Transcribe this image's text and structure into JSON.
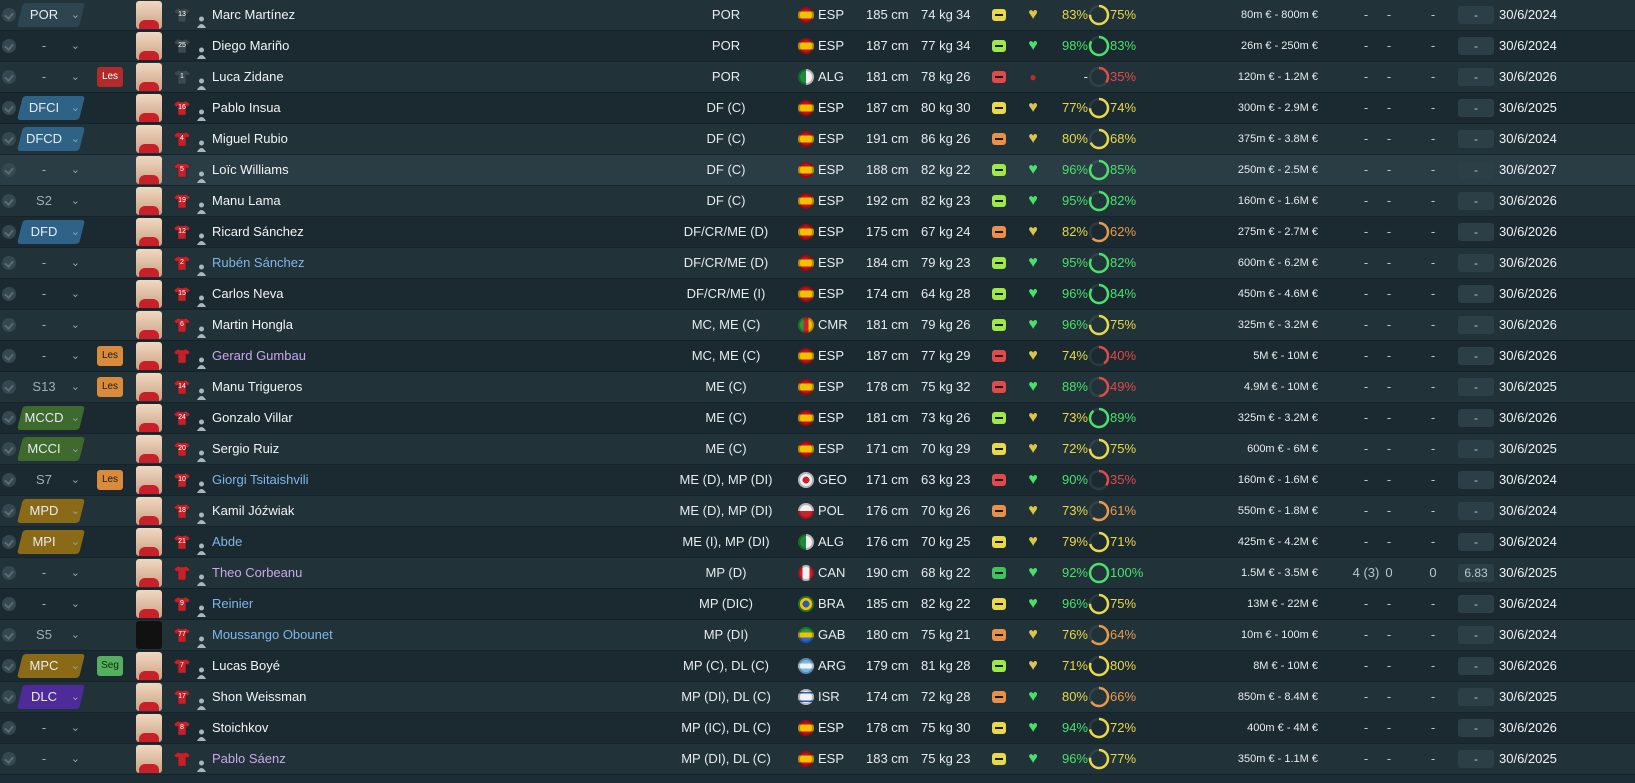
{
  "players": [
    {
      "pos_sel": "POR",
      "pos_style": "grey",
      "tag": "",
      "shirt_num": "13",
      "name": "Marc Martínez",
      "name_color": "white",
      "positions": "POR",
      "nationality": "ESP",
      "flag": "esp",
      "height": "185 cm",
      "weight": "74 kg",
      "age": "34",
      "status": "yellow",
      "morale": "yellow",
      "condition": "83%",
      "cond_color": "#e8d84a",
      "sharpness": "75%",
      "sharp_color": "#e8d84a",
      "sharp_frac": 0.75,
      "value": "80m € - 800m €",
      "apps": "-",
      "goals": "-",
      "assists": "-",
      "rating": "-",
      "contract": "30/6/2024"
    },
    {
      "pos_sel": "-",
      "pos_style": "none",
      "tag": "",
      "shirt_num": "25",
      "name": "Diego Mariño",
      "name_color": "white",
      "positions": "POR",
      "nationality": "ESP",
      "flag": "esp",
      "height": "187 cm",
      "weight": "77 kg",
      "age": "34",
      "status": "lime",
      "morale": "green",
      "condition": "98%",
      "cond_color": "#4ae06a",
      "sharpness": "83%",
      "sharp_color": "#4ae06a",
      "sharp_frac": 0.83,
      "value": "26m € - 250m €",
      "apps": "-",
      "goals": "-",
      "assists": "-",
      "rating": "-",
      "contract": "30/6/2024"
    },
    {
      "pos_sel": "-",
      "pos_style": "none",
      "tag": "Les",
      "tag_style": "les-red",
      "shirt_num": "1",
      "name": "Luca Zidane",
      "name_color": "white",
      "positions": "POR",
      "nationality": "ALG",
      "flag": "alg",
      "height": "181 cm",
      "weight": "78 kg",
      "age": "26",
      "status": "red",
      "morale": "red",
      "condition": "-",
      "cond_color": "#e6ecef",
      "sharpness": "35%",
      "sharp_color": "#e04a4a",
      "sharp_frac": 0.35,
      "value": "120m € - 1.2M €",
      "apps": "-",
      "goals": "-",
      "assists": "-",
      "rating": "-",
      "contract": "30/6/2026"
    },
    {
      "pos_sel": "DFCI",
      "pos_style": "blue",
      "tag": "",
      "shirt_num": "16",
      "name": "Pablo Insua",
      "name_color": "white",
      "positions": "DF (C)",
      "nationality": "ESP",
      "flag": "esp",
      "height": "187 cm",
      "weight": "80 kg",
      "age": "30",
      "status": "yellow",
      "morale": "yellow",
      "condition": "77%",
      "cond_color": "#e8d84a",
      "sharpness": "74%",
      "sharp_color": "#e8d84a",
      "sharp_frac": 0.74,
      "value": "300m € - 2.9M €",
      "apps": "-",
      "goals": "-",
      "assists": "-",
      "rating": "-",
      "contract": "30/6/2025"
    },
    {
      "pos_sel": "DFCD",
      "pos_style": "blue",
      "tag": "",
      "shirt_num": "4",
      "name": "Miguel Rubio",
      "name_color": "white",
      "positions": "DF (C)",
      "nationality": "ESP",
      "flag": "esp",
      "height": "191 cm",
      "weight": "86 kg",
      "age": "26",
      "status": "orange",
      "morale": "yellow",
      "condition": "80%",
      "cond_color": "#e8d84a",
      "sharpness": "68%",
      "sharp_color": "#e8d84a",
      "sharp_frac": 0.68,
      "value": "375m € - 3.8M €",
      "apps": "-",
      "goals": "-",
      "assists": "-",
      "rating": "-",
      "contract": "30/6/2024"
    },
    {
      "pos_sel": "-",
      "pos_style": "none",
      "tag": "",
      "shirt_num": "5",
      "name": "Loïc Williams",
      "name_color": "white",
      "positions": "DF (C)",
      "nationality": "ESP",
      "flag": "esp",
      "height": "188 cm",
      "weight": "82 kg",
      "age": "22",
      "status": "lime",
      "morale": "green",
      "condition": "96%",
      "cond_color": "#4ae06a",
      "sharpness": "85%",
      "sharp_color": "#4ae06a",
      "sharp_frac": 0.85,
      "value": "250m € - 2.5M €",
      "apps": "-",
      "goals": "-",
      "assists": "-",
      "rating": "-",
      "contract": "30/6/2027"
    },
    {
      "pos_sel": "S2",
      "pos_style": "none",
      "tag": "",
      "shirt_num": "19",
      "name": "Manu Lama",
      "name_color": "white",
      "positions": "DF (C)",
      "nationality": "ESP",
      "flag": "esp",
      "height": "192 cm",
      "weight": "82 kg",
      "age": "23",
      "status": "lime",
      "morale": "green",
      "condition": "95%",
      "cond_color": "#4ae06a",
      "sharpness": "82%",
      "sharp_color": "#4ae06a",
      "sharp_frac": 0.82,
      "value": "160m € - 1.6M €",
      "apps": "-",
      "goals": "-",
      "assists": "-",
      "rating": "-",
      "contract": "30/6/2026"
    },
    {
      "pos_sel": "DFD",
      "pos_style": "blue",
      "tag": "",
      "shirt_num": "12",
      "name": "Ricard Sánchez",
      "name_color": "white",
      "positions": "DF/CR/ME (D)",
      "nationality": "ESP",
      "flag": "esp",
      "height": "175 cm",
      "weight": "67 kg",
      "age": "24",
      "status": "orange",
      "morale": "yellow",
      "condition": "82%",
      "cond_color": "#e8d84a",
      "sharpness": "62%",
      "sharp_color": "#e89a4a",
      "sharp_frac": 0.62,
      "value": "275m € - 2.7M €",
      "apps": "-",
      "goals": "-",
      "assists": "-",
      "rating": "-",
      "contract": "30/6/2026"
    },
    {
      "pos_sel": "-",
      "pos_style": "none",
      "tag": "",
      "shirt_num": "2",
      "name": "Rubén Sánchez",
      "name_color": "blue",
      "positions": "DF/CR/ME (D)",
      "nationality": "ESP",
      "flag": "esp",
      "height": "184 cm",
      "weight": "79 kg",
      "age": "23",
      "status": "lime",
      "morale": "green",
      "condition": "95%",
      "cond_color": "#4ae06a",
      "sharpness": "82%",
      "sharp_color": "#4ae06a",
      "sharp_frac": 0.82,
      "value": "600m € - 6.2M €",
      "apps": "-",
      "goals": "-",
      "assists": "-",
      "rating": "-",
      "contract": "30/6/2026"
    },
    {
      "pos_sel": "-",
      "pos_style": "none",
      "tag": "",
      "shirt_num": "15",
      "name": "Carlos Neva",
      "name_color": "white",
      "positions": "DF/CR/ME (I)",
      "nationality": "ESP",
      "flag": "esp",
      "height": "174 cm",
      "weight": "64 kg",
      "age": "28",
      "status": "lime",
      "morale": "green",
      "condition": "96%",
      "cond_color": "#4ae06a",
      "sharpness": "84%",
      "sharp_color": "#4ae06a",
      "sharp_frac": 0.84,
      "value": "450m € - 4.6M €",
      "apps": "-",
      "goals": "-",
      "assists": "-",
      "rating": "-",
      "contract": "30/6/2026"
    },
    {
      "pos_sel": "-",
      "pos_style": "none",
      "tag": "",
      "shirt_num": "6",
      "name": "Martin Hongla",
      "name_color": "white",
      "positions": "MC, ME (C)",
      "nationality": "CMR",
      "flag": "cmr",
      "height": "181 cm",
      "weight": "79 kg",
      "age": "26",
      "status": "lime",
      "morale": "green",
      "condition": "96%",
      "cond_color": "#4ae06a",
      "sharpness": "75%",
      "sharp_color": "#e8d84a",
      "sharp_frac": 0.75,
      "value": "325m € - 3.2M €",
      "apps": "-",
      "goals": "-",
      "assists": "-",
      "rating": "-",
      "contract": "30/6/2026"
    },
    {
      "pos_sel": "-",
      "pos_style": "none",
      "tag": "Les",
      "tag_style": "les",
      "shirt_num": "",
      "name": "Gerard Gumbau",
      "name_color": "purple",
      "positions": "MC, ME (C)",
      "nationality": "ESP",
      "flag": "esp",
      "height": "187 cm",
      "weight": "77 kg",
      "age": "29",
      "status": "red",
      "morale": "yellow",
      "condition": "74%",
      "cond_color": "#e8d84a",
      "sharpness": "40%",
      "sharp_color": "#e04a4a",
      "sharp_frac": 0.4,
      "value": "5M € - 10M €",
      "apps": "-",
      "goals": "-",
      "assists": "-",
      "rating": "-",
      "contract": "30/6/2026"
    },
    {
      "pos_sel": "S13",
      "pos_style": "none",
      "tag": "Les",
      "tag_style": "les",
      "shirt_num": "14",
      "name": "Manu Trigueros",
      "name_color": "white",
      "positions": "ME (C)",
      "nationality": "ESP",
      "flag": "esp",
      "height": "178 cm",
      "weight": "75 kg",
      "age": "32",
      "status": "red",
      "morale": "green",
      "condition": "88%",
      "cond_color": "#4ae06a",
      "sharpness": "49%",
      "sharp_color": "#e04a4a",
      "sharp_frac": 0.49,
      "value": "4.9M € - 10M €",
      "apps": "-",
      "goals": "-",
      "assists": "-",
      "rating": "-",
      "contract": "30/6/2025"
    },
    {
      "pos_sel": "MCCD",
      "pos_style": "green",
      "tag": "",
      "shirt_num": "24",
      "name": "Gonzalo Villar",
      "name_color": "white",
      "positions": "ME (C)",
      "nationality": "ESP",
      "flag": "esp",
      "height": "181 cm",
      "weight": "73 kg",
      "age": "26",
      "status": "lime",
      "morale": "yellow",
      "condition": "73%",
      "cond_color": "#e8d84a",
      "sharpness": "89%",
      "sharp_color": "#4ae06a",
      "sharp_frac": 0.89,
      "value": "325m € - 3.2M €",
      "apps": "-",
      "goals": "-",
      "assists": "-",
      "rating": "-",
      "contract": "30/6/2026"
    },
    {
      "pos_sel": "MCCI",
      "pos_style": "green",
      "tag": "",
      "shirt_num": "20",
      "name": "Sergio Ruiz",
      "name_color": "white",
      "positions": "ME (C)",
      "nationality": "ESP",
      "flag": "esp",
      "height": "171 cm",
      "weight": "70 kg",
      "age": "29",
      "status": "yellow",
      "morale": "yellow",
      "condition": "72%",
      "cond_color": "#e8d84a",
      "sharpness": "75%",
      "sharp_color": "#e8d84a",
      "sharp_frac": 0.75,
      "value": "600m € - 6M €",
      "apps": "-",
      "goals": "-",
      "assists": "-",
      "rating": "-",
      "contract": "30/6/2025"
    },
    {
      "pos_sel": "S7",
      "pos_style": "none",
      "tag": "Les",
      "tag_style": "les",
      "shirt_num": "10",
      "name": "Giorgi Tsitaishvili",
      "name_color": "blue",
      "positions": "ME (D), MP (DI)",
      "nationality": "GEO",
      "flag": "geo",
      "height": "171 cm",
      "weight": "63 kg",
      "age": "23",
      "status": "red",
      "morale": "green",
      "condition": "90%",
      "cond_color": "#4ae06a",
      "sharpness": "35%",
      "sharp_color": "#e04a4a",
      "sharp_frac": 0.35,
      "value": "160m € - 1.6M €",
      "apps": "-",
      "goals": "-",
      "assists": "-",
      "rating": "-",
      "contract": "30/6/2024"
    },
    {
      "pos_sel": "MPD",
      "pos_style": "gold",
      "tag": "",
      "shirt_num": "18",
      "name": "Kamil Jóźwiak",
      "name_color": "white",
      "positions": "ME (D), MP (DI)",
      "nationality": "POL",
      "flag": "pol",
      "height": "176 cm",
      "weight": "70 kg",
      "age": "26",
      "status": "orange",
      "morale": "yellow",
      "condition": "73%",
      "cond_color": "#e8d84a",
      "sharpness": "61%",
      "sharp_color": "#e89a4a",
      "sharp_frac": 0.61,
      "value": "550m € - 1.8M €",
      "apps": "-",
      "goals": "-",
      "assists": "-",
      "rating": "-",
      "contract": "30/6/2024"
    },
    {
      "pos_sel": "MPI",
      "pos_style": "gold",
      "tag": "",
      "shirt_num": "21",
      "name": "Abde",
      "name_color": "blue",
      "positions": "ME (I), MP (DI)",
      "nationality": "ALG",
      "flag": "alg",
      "height": "176 cm",
      "weight": "70 kg",
      "age": "25",
      "status": "yellow",
      "morale": "yellow",
      "condition": "79%",
      "cond_color": "#e8d84a",
      "sharpness": "71%",
      "sharp_color": "#e8d84a",
      "sharp_frac": 0.71,
      "value": "425m € - 4.2M €",
      "apps": "-",
      "goals": "-",
      "assists": "-",
      "rating": "-",
      "contract": "30/6/2024"
    },
    {
      "pos_sel": "-",
      "pos_style": "none",
      "tag": "",
      "shirt_num": "",
      "name": "Theo Corbeanu",
      "name_color": "purple",
      "positions": "MP (D)",
      "nationality": "CAN",
      "flag": "can",
      "height": "190 cm",
      "weight": "68 kg",
      "age": "22",
      "status": "green",
      "morale": "green",
      "condition": "92%",
      "cond_color": "#4ae06a",
      "sharpness": "100%",
      "sharp_color": "#4ae06a",
      "sharp_frac": 1.0,
      "value": "1.5M € - 3.5M €",
      "apps": "4 (3)",
      "goals": "0",
      "assists": "0",
      "rating": "6.83",
      "contract": "30/6/2025"
    },
    {
      "pos_sel": "-",
      "pos_style": "none",
      "tag": "",
      "shirt_num": "9",
      "name": "Reinier",
      "name_color": "blue",
      "positions": "MP (DIC)",
      "nationality": "BRA",
      "flag": "bra",
      "height": "185 cm",
      "weight": "82 kg",
      "age": "22",
      "status": "yellow",
      "morale": "green",
      "condition": "96%",
      "cond_color": "#4ae06a",
      "sharpness": "75%",
      "sharp_color": "#e8d84a",
      "sharp_frac": 0.75,
      "value": "13M € - 22M €",
      "apps": "-",
      "goals": "-",
      "assists": "-",
      "rating": "-",
      "contract": "30/6/2024"
    },
    {
      "pos_sel": "S5",
      "pos_style": "none",
      "tag": "",
      "shirt_num": "77",
      "name": "Moussango Obounet",
      "name_color": "blue",
      "positions": "MP (DI)",
      "nationality": "GAB",
      "flag": "gab",
      "height": "180 cm",
      "weight": "75 kg",
      "age": "21",
      "status": "orange",
      "morale": "yellow",
      "condition": "76%",
      "cond_color": "#e8d84a",
      "sharpness": "64%",
      "sharp_color": "#e89a4a",
      "sharp_frac": 0.64,
      "value": "10m € - 100m €",
      "apps": "-",
      "goals": "-",
      "assists": "-",
      "rating": "-",
      "contract": "30/6/2024",
      "dark_face": true
    },
    {
      "pos_sel": "MPC",
      "pos_style": "gold",
      "tag": "Seg",
      "tag_style": "seg",
      "shirt_num": "7",
      "name": "Lucas Boyé",
      "name_color": "white",
      "positions": "MP (C), DL (C)",
      "nationality": "ARG",
      "flag": "arg",
      "height": "179 cm",
      "weight": "81 kg",
      "age": "28",
      "status": "lime",
      "morale": "yellow",
      "condition": "71%",
      "cond_color": "#e8d84a",
      "sharpness": "80%",
      "sharp_color": "#e8d84a",
      "sharp_frac": 0.8,
      "value": "8M € - 10M €",
      "apps": "-",
      "goals": "-",
      "assists": "-",
      "rating": "-",
      "contract": "30/6/2026"
    },
    {
      "pos_sel": "DLC",
      "pos_style": "purple",
      "tag": "",
      "shirt_num": "17",
      "name": "Shon Weissman",
      "name_color": "white",
      "positions": "MP (DI), DL (C)",
      "nationality": "ISR",
      "flag": "isr",
      "height": "174 cm",
      "weight": "72 kg",
      "age": "28",
      "status": "orange",
      "morale": "green",
      "condition": "80%",
      "cond_color": "#e8d84a",
      "sharpness": "66%",
      "sharp_color": "#e89a4a",
      "sharp_frac": 0.66,
      "value": "850m € - 8.4M €",
      "apps": "-",
      "goals": "-",
      "assists": "-",
      "rating": "-",
      "contract": "30/6/2025"
    },
    {
      "pos_sel": "-",
      "pos_style": "none",
      "tag": "",
      "shirt_num": "8",
      "name": "Stoichkov",
      "name_color": "white",
      "positions": "MP (IC), DL (C)",
      "nationality": "ESP",
      "flag": "esp",
      "height": "178 cm",
      "weight": "75 kg",
      "age": "30",
      "status": "yellow",
      "morale": "green",
      "condition": "94%",
      "cond_color": "#4ae06a",
      "sharpness": "72%",
      "sharp_color": "#e8d84a",
      "sharp_frac": 0.72,
      "value": "400m € - 4M €",
      "apps": "-",
      "goals": "-",
      "assists": "-",
      "rating": "-",
      "contract": "30/6/2026"
    },
    {
      "pos_sel": "-",
      "pos_style": "none",
      "tag": "",
      "shirt_num": "",
      "name": "Pablo Sáenz",
      "name_color": "purple",
      "positions": "MP (DI), DL (C)",
      "nationality": "ESP",
      "flag": "esp",
      "height": "183 cm",
      "weight": "75 kg",
      "age": "23",
      "status": "yellow",
      "morale": "green",
      "condition": "96%",
      "cond_color": "#4ae06a",
      "sharpness": "77%",
      "sharp_color": "#e8d84a",
      "sharp_frac": 0.77,
      "value": "350m € - 1.1M €",
      "apps": "-",
      "goals": "-",
      "assists": "-",
      "rating": "-",
      "contract": "30/6/2025"
    }
  ],
  "colors": {
    "status": {
      "yellow": "#e8d84a",
      "lime": "#9ee84a",
      "orange": "#e8904a",
      "red": "#e04a4a",
      "green": "#3ec45a"
    },
    "morale": {
      "yellow": "#d8c84a",
      "green": "#4ae06a",
      "red": "#c02a2a"
    },
    "flags": {
      "esp": "#d8b018",
      "alg": "#2a9a4a",
      "cmr": "#c0281e",
      "geo": "#f2f2f2",
      "pol": "#e8e8e8",
      "can": "#e8e8e8",
      "bra": "#2a9a3a",
      "gab": "#2a8ad8",
      "arg": "#78b8e8",
      "isr": "#e8e8f8"
    }
  },
  "icons": {
    "check": "check-icon",
    "chevron": "chevron-down-icon",
    "heart": "morale-heart-icon",
    "gk": "person-icon"
  }
}
